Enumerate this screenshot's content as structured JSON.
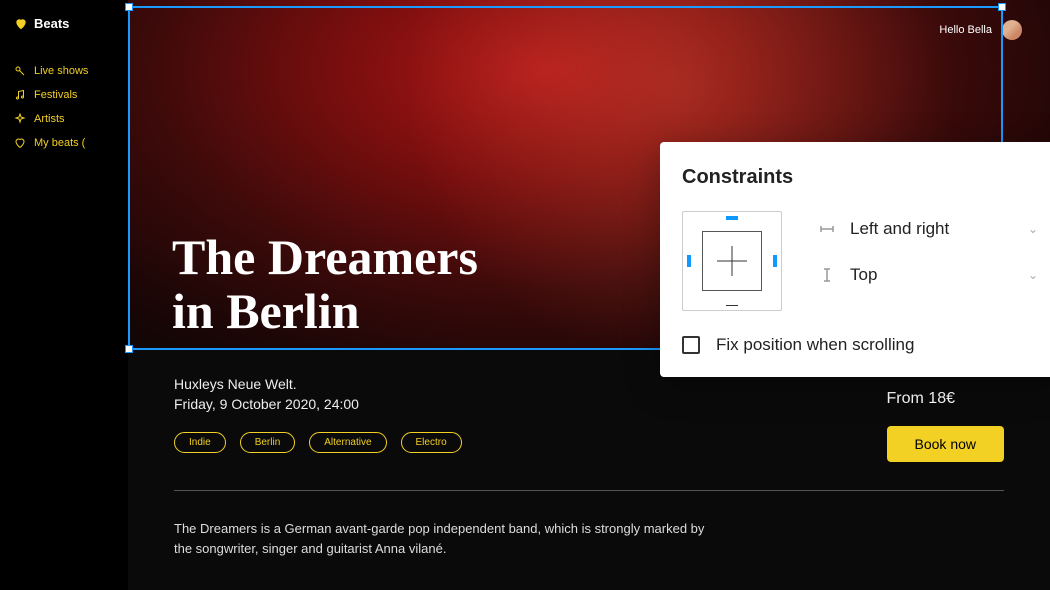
{
  "sidebar": {
    "brand": "Beats",
    "items": [
      {
        "label": "Live shows"
      },
      {
        "label": "Festivals"
      },
      {
        "label": "Artists"
      },
      {
        "label": "My beats ("
      }
    ]
  },
  "user": {
    "greeting": "Hello Bella"
  },
  "hero": {
    "title_line1": "The Dreamers",
    "title_line2": "in Berlin"
  },
  "event": {
    "venue": "Huxleys Neue Welt.",
    "datetime": "Friday,  9 October 2020, 24:00",
    "tags": [
      "Indie",
      "Berlin",
      "Alternative",
      "Electro"
    ],
    "price": "From 18€",
    "book_label": "Book now",
    "description": "The Dreamers is a German avant-garde pop independent band, which is strongly marked by the songwriter, singer and guitarist Anna vilané."
  },
  "constraints": {
    "title": "Constraints",
    "horizontal": "Left and right",
    "vertical": "Top",
    "fix_label": "Fix position when scrolling"
  },
  "colors": {
    "accent_yellow": "#f2d024",
    "selection_blue": "#1a9aff"
  }
}
